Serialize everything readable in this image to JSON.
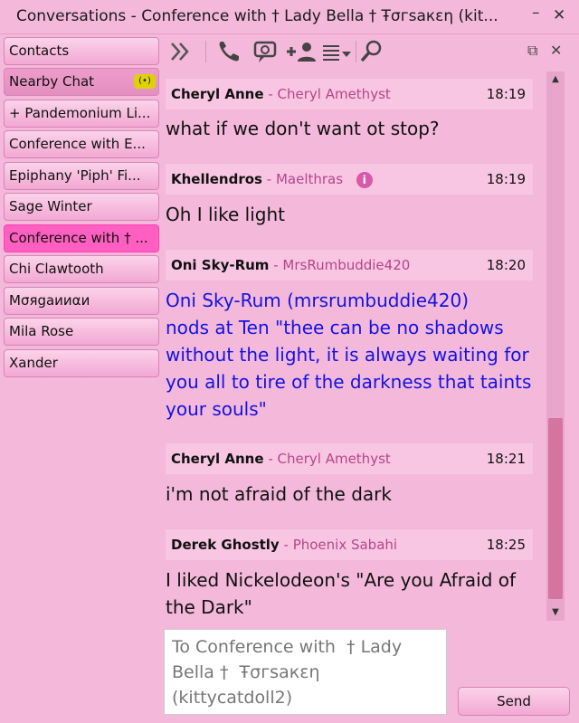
{
  "window": {
    "title": "Conversations - Conference with  † Lady Bella †  Ŧσгsaкɛη (kit...",
    "minimize_glyph": "–",
    "close_glyph": "✕"
  },
  "sidebar": {
    "items": [
      {
        "label": "Contacts"
      },
      {
        "label": "Nearby Chat",
        "indicator": "(•)"
      },
      {
        "label": "+ Pandemonium Li..."
      },
      {
        "label": "Conference with  E..."
      },
      {
        "label": "Epiphany 'Piph' Fi..."
      },
      {
        "label": "Sage Winter"
      },
      {
        "label": "Conference with  † ..."
      },
      {
        "label": "Chi Clawtooth"
      },
      {
        "label": "Mσяgaииαи"
      },
      {
        "label": "Mila Rose"
      },
      {
        "label": "Xander"
      }
    ]
  },
  "toolbar": {
    "icons": [
      "collapse-icon",
      "call-icon",
      "chat-history-icon",
      "add-participant-icon",
      "options-menu-icon",
      "search-icon"
    ],
    "tear_off_glyph": "⧉",
    "close_glyph": "✕"
  },
  "messages": [
    {
      "sender": "Cheryl Anne",
      "display": "Cheryl Amethyst",
      "time": "18:19",
      "text": "what if we don't want ot stop?",
      "emote": false
    },
    {
      "sender": "Khellendros",
      "display": "Maelthras",
      "time": "18:19",
      "text": "Oh I like light",
      "emote": false,
      "info": "i"
    },
    {
      "sender": "Oni Sky-Rum",
      "display": "MrsRumbuddie420",
      "time": "18:20",
      "text": "Oni Sky-Rum (mrsrumbuddie420)\n nods at Ten \"thee can be no shadows without the light, it is always waiting for you all to tire of the darkness that taints your souls\"",
      "emote": true
    },
    {
      "sender": "Cheryl Anne",
      "display": "Cheryl Amethyst",
      "time": "18:21",
      "text": "i'm not afraid of the dark",
      "emote": false
    },
    {
      "sender": "Derek Ghostly",
      "display": "Phoenix Sabahi",
      "time": "18:25",
      "text": "I liked Nickelodeon's \"Are you Afraid of the Dark\"",
      "emote": false
    }
  ],
  "input": {
    "placeholder": "To Conference with  † Lady Bella †  Ŧσгsaкɛη (kittycatdoll2)",
    "value": ""
  },
  "send_label": "Send",
  "colors": {
    "background": "#f3b8da",
    "active_tab": "#ff5fc0",
    "emote_text": "#1313e0",
    "display_name": "#b54689"
  }
}
